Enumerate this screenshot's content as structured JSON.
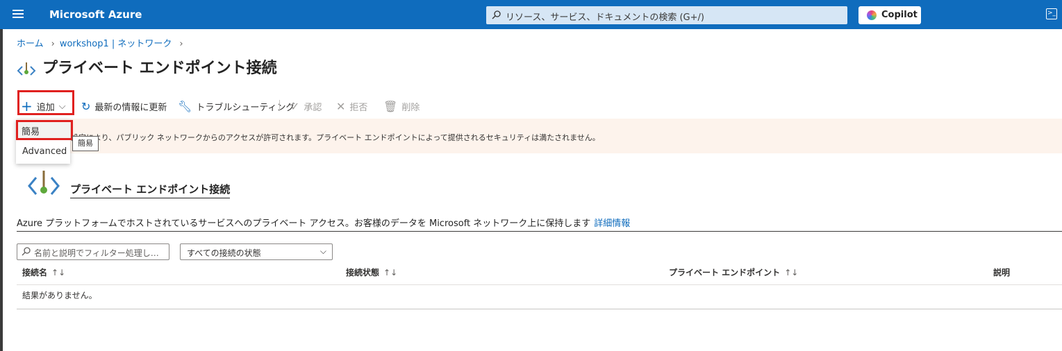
{
  "topbar": {
    "brand": "Microsoft Azure",
    "search_placeholder": "リソース、サービス、ドキュメントの検索 (G+/)",
    "copilot_label": "Copilot",
    "accent": "#0f6cbd"
  },
  "breadcrumb": {
    "items": [
      "ホーム",
      "workshop1 | ネットワーク"
    ]
  },
  "page": {
    "title": "プライベート エンドポイント接続",
    "more": "···"
  },
  "toolbar": {
    "add_label": "追加",
    "refresh_label": "最新の情報に更新",
    "troubleshoot_label": "トラブルシューティング",
    "approve_label": "承認",
    "reject_label": "拒否",
    "delete_label": "削除"
  },
  "add_menu": {
    "items": [
      "簡易",
      "Advanced"
    ],
    "tooltip": "簡易"
  },
  "warning": {
    "text": "現在の設定により、パブリック ネットワークからのアクセスが許可されます。プライベート エンドポイントによって提供されるセキュリティは満たされません。",
    "visible_text": "設定により、パブリック ネットワークからのアクセスが許可されます。プライベート エンドポイントによって提供されるセキュリティは満たされません。"
  },
  "section": {
    "title": "プライベート エンドポイント接続",
    "description": "Azure プラットフォームでホストされているサービスへのプライベート アクセス。お客様のデータを Microsoft ネットワーク上に保持します",
    "link": "詳細情報"
  },
  "filters": {
    "search_placeholder": "名前と説明でフィルター処理し…",
    "state_select": "すべての接続の状態"
  },
  "table": {
    "columns": [
      "接続名",
      "接続状態",
      "プライベート エンドポイント",
      "説明"
    ],
    "sort_glyph": "↑↓",
    "empty_text": "結果がありません。"
  }
}
